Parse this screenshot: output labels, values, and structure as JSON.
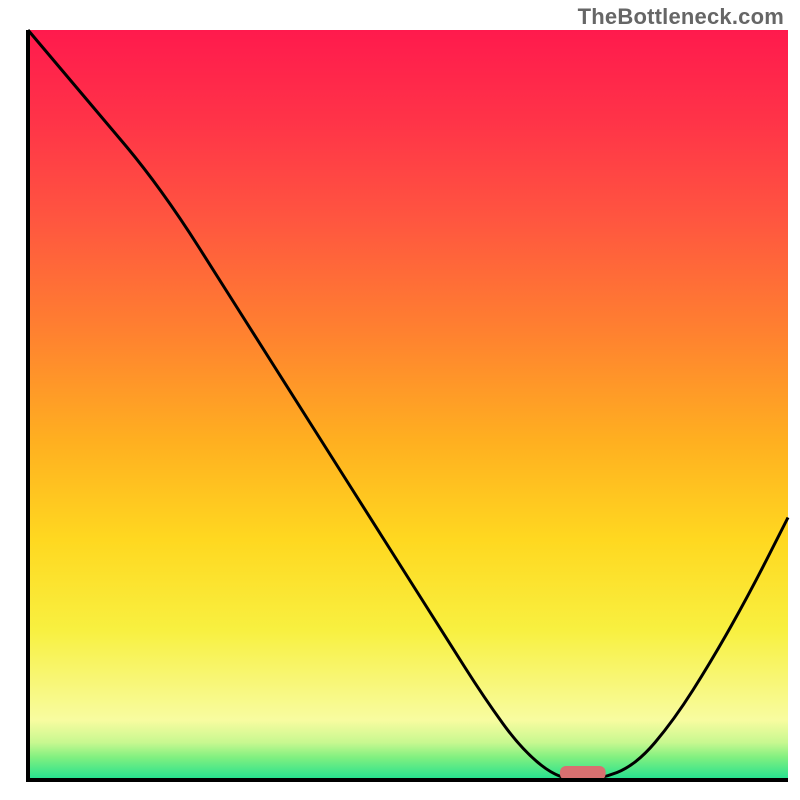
{
  "watermark": "TheBottleneck.com",
  "chart_data": {
    "type": "line",
    "title": "",
    "xlabel": "",
    "ylabel": "",
    "xlim": [
      0,
      100
    ],
    "ylim": [
      0,
      100
    ],
    "series": [
      {
        "name": "bottleneck-curve",
        "x": [
          0,
          5,
          10,
          15,
          20,
          25,
          30,
          35,
          40,
          45,
          50,
          55,
          60,
          65,
          70,
          75,
          80,
          85,
          90,
          95,
          100
        ],
        "values": [
          100,
          94,
          88,
          82,
          75,
          67,
          59,
          51,
          43,
          35,
          27,
          19,
          11,
          4,
          0,
          0,
          2,
          8,
          16,
          25,
          35
        ]
      }
    ],
    "optimal_marker": {
      "x_start": 70,
      "x_end": 76,
      "color": "#d87070"
    },
    "axes": {
      "stroke": "#000000",
      "stroke_width": 4
    },
    "gradient_stops": [
      {
        "offset": 0,
        "color": "#ff1a4d"
      },
      {
        "offset": 12,
        "color": "#ff3348"
      },
      {
        "offset": 25,
        "color": "#ff5540"
      },
      {
        "offset": 40,
        "color": "#ff8030"
      },
      {
        "offset": 55,
        "color": "#ffb020"
      },
      {
        "offset": 68,
        "color": "#ffd820"
      },
      {
        "offset": 80,
        "color": "#f8f040"
      },
      {
        "offset": 88,
        "color": "#f8f880"
      },
      {
        "offset": 92,
        "color": "#f8fca0"
      },
      {
        "offset": 95,
        "color": "#c8f890"
      },
      {
        "offset": 97,
        "color": "#80f080"
      },
      {
        "offset": 100,
        "color": "#20e090"
      }
    ]
  }
}
